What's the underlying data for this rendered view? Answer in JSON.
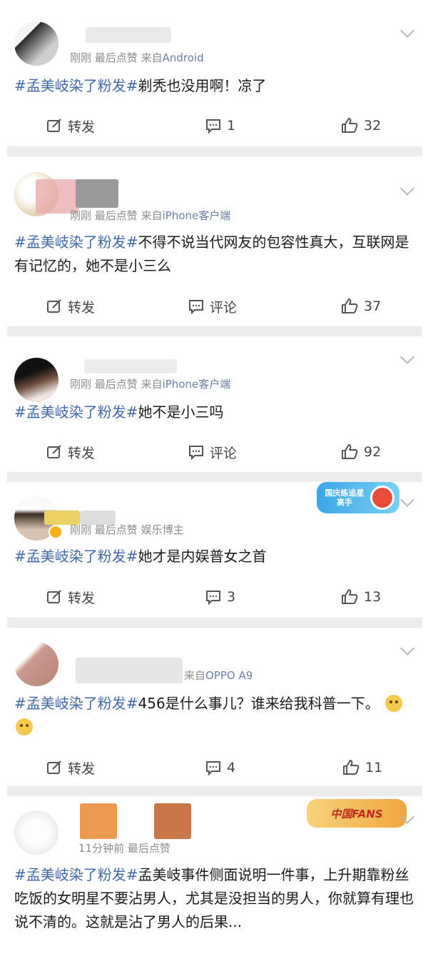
{
  "actions": {
    "repost_label": "转发",
    "comment_label": "评论"
  },
  "comments": [
    {
      "meta_time": "刚刚",
      "meta_like": "最后点赞",
      "meta_from": "来自",
      "meta_source": "Android",
      "tag": "#孟美岐染了粉发#",
      "body": "剃秃也没用啊！凉了",
      "comment_count": "1",
      "like_count": "32"
    },
    {
      "meta_time": "刚刚",
      "meta_like": "最后点赞",
      "meta_from": "来自",
      "meta_source": "iPhone客户端",
      "tag": "#孟美岐染了粉发#",
      "body": "不得不说当代网友的包容性真大，互联网是有记忆的，她不是小三么",
      "comment_count": "评论",
      "like_count": "37"
    },
    {
      "meta_time": "刚刚",
      "meta_like": "最后点赞",
      "meta_from": "来自",
      "meta_source": "iPhone客户端",
      "tag": "#孟美岐染了粉发#",
      "body": "她不是小三吗",
      "comment_count": "评论",
      "like_count": "92"
    },
    {
      "meta_time": "刚刚",
      "meta_like": "最后点赞",
      "meta_from": "",
      "meta_source": "娱乐博主",
      "tag": "#孟美岐染了粉发#",
      "body": "她才是内娱普女之首",
      "comment_count": "3",
      "like_count": "13",
      "badge": "国庆练追星高手"
    },
    {
      "meta_time": "",
      "meta_like": "",
      "meta_from": "来自",
      "meta_source": "OPPO A9",
      "tag": "#孟美岐染了粉发#",
      "body": "456是什么事儿？谁来给我科普一下。",
      "comment_count": "4",
      "like_count": "11"
    },
    {
      "meta_time": "11分钟前",
      "meta_like": "最后点赞",
      "meta_from": "",
      "meta_source": "",
      "tag": "#孟美岐染了粉发#",
      "body": "孟美岐事件侧面说明一件事，上升期靠粉丝吃饭的女明星不要沾男人，尤其是没担当的男人，你就算有理也说不清的。这就是沾了男人的后果...",
      "badge": "中国FANS"
    }
  ],
  "colors": {
    "tag": "#3f68a5",
    "source": "#6b7fa3",
    "separator": "#ececec"
  }
}
